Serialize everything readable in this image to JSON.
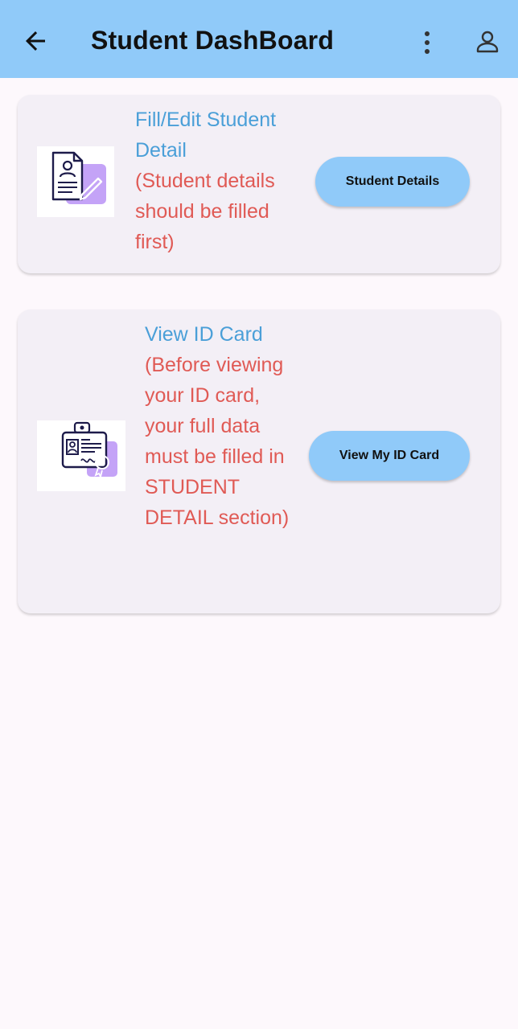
{
  "app_bar": {
    "title": "Student DashBoard",
    "back_icon": "arrow-left-icon",
    "menu_icon": "more-vert-icon",
    "profile_icon": "person-outline-icon",
    "background": "#90caf9"
  },
  "cards": [
    {
      "title": "Fill/Edit Student Detail",
      "note": "(Student details should be filled first)",
      "button_label": "Student Details",
      "icon": "id-document-edit-icon"
    },
    {
      "title": "View ID Card",
      "note": "(Before viewing your ID card, your full data must be filled in STUDENT DETAIL section)",
      "button_label": "View My ID Card",
      "icon": "id-card-badge-icon"
    }
  ],
  "colors": {
    "title_text": "#4a9fd8",
    "note_text": "#e05a55",
    "button": "#90caf9",
    "card": "#f3eff6",
    "page": "#fdf8fc"
  }
}
